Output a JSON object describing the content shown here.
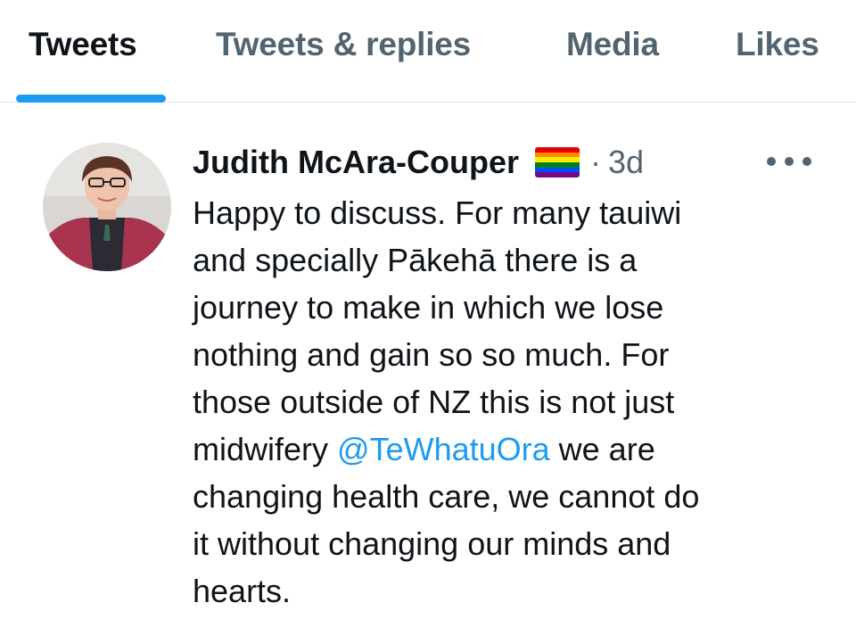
{
  "tabs": [
    {
      "label": "Tweets",
      "active": true
    },
    {
      "label": "Tweets & replies",
      "active": false
    },
    {
      "label": "Media",
      "active": false
    },
    {
      "label": "Likes",
      "active": false
    }
  ],
  "tweet": {
    "author_name": "Judith McAra-Couper",
    "author_badge_icon": "rainbow-flag-icon",
    "separator": "·",
    "time_ago": "3d",
    "more_icon": "more-horizontal-icon",
    "text_lines": [
      "Happy to discuss. For many tauiwi",
      "and specially Pākehā there is a",
      "journey to make in which we lose",
      "nothing and gain so so much. For",
      "those outside of NZ this is not just"
    ],
    "line6_before": "midwifery ",
    "mention": "@TeWhatuOra",
    "line6_after": " we are",
    "text_lines_end": [
      "changing health care, we cannot do",
      "it without changing our minds and",
      "hearts."
    ]
  },
  "colors": {
    "accent": "#1d9bf0",
    "text_primary": "#0f1419",
    "text_secondary": "#536471",
    "divider": "#e1e4e7"
  }
}
